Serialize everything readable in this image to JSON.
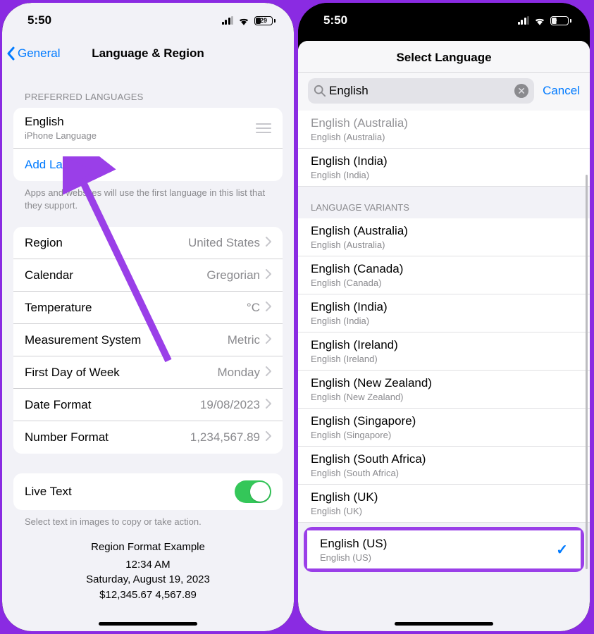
{
  "status": {
    "time": "5:50",
    "battery": "29"
  },
  "screen1": {
    "back": "General",
    "title": "Language & Region",
    "preferred_header": "PREFERRED LANGUAGES",
    "language": {
      "name": "English",
      "subtitle": "iPhone Language"
    },
    "add_language": "Add Language…",
    "apps_note": "Apps and websites will use the first language in this list that they support.",
    "settings": [
      {
        "label": "Region",
        "value": "United States"
      },
      {
        "label": "Calendar",
        "value": "Gregorian"
      },
      {
        "label": "Temperature",
        "value": "°C"
      },
      {
        "label": "Measurement System",
        "value": "Metric"
      },
      {
        "label": "First Day of Week",
        "value": "Monday"
      },
      {
        "label": "Date Format",
        "value": "19/08/2023"
      },
      {
        "label": "Number Format",
        "value": "1,234,567.89"
      }
    ],
    "live_text": "Live Text",
    "live_text_note": "Select text in images to copy or take action.",
    "example": {
      "title": "Region Format Example",
      "time": "12:34 AM",
      "date": "Saturday, August 19, 2023",
      "numbers": "$12,345.67   4,567.89"
    }
  },
  "screen2": {
    "title": "Select Language",
    "search_value": "English",
    "cancel": "Cancel",
    "top_results": [
      {
        "native": "English (Australia)",
        "local": "English (Australia)",
        "dimmed": true
      },
      {
        "native": "English (India)",
        "local": "English (India)"
      }
    ],
    "variants_header": "LANGUAGE VARIANTS",
    "variants": [
      {
        "native": "English (Australia)",
        "local": "English (Australia)"
      },
      {
        "native": "English (Canada)",
        "local": "English (Canada)"
      },
      {
        "native": "English (India)",
        "local": "English (India)"
      },
      {
        "native": "English (Ireland)",
        "local": "English (Ireland)"
      },
      {
        "native": "English (New Zealand)",
        "local": "English (New Zealand)"
      },
      {
        "native": "English (Singapore)",
        "local": "English (Singapore)"
      },
      {
        "native": "English (South Africa)",
        "local": "English (South Africa)"
      },
      {
        "native": "English (UK)",
        "local": "English (UK)"
      }
    ],
    "selected": {
      "native": "English (US)",
      "local": "English (US)"
    }
  }
}
